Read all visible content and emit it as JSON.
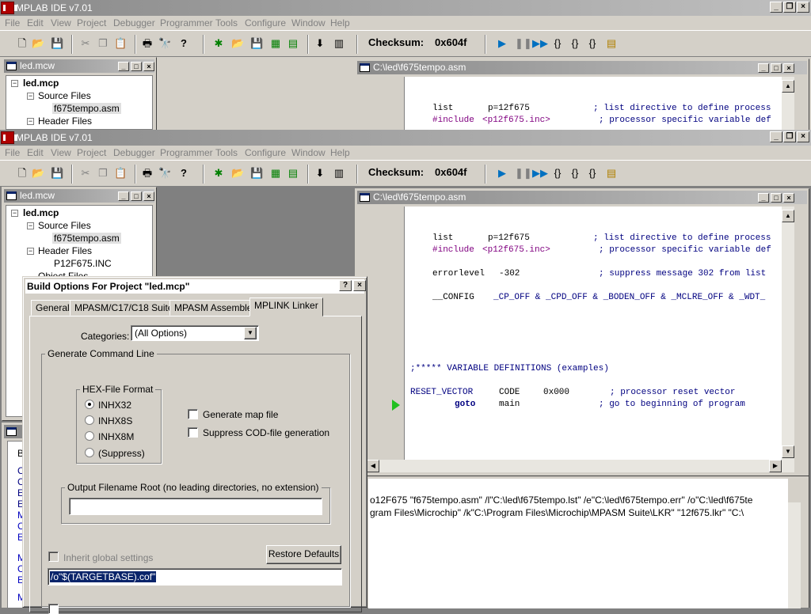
{
  "app": {
    "title": "MPLAB IDE v7.01",
    "menu": [
      "File",
      "Edit",
      "View",
      "Project",
      "Debugger",
      "Programmer",
      "Tools",
      "Configure",
      "Window",
      "Help"
    ],
    "checksum_label": "Checksum:",
    "checksum_value": "0x604f"
  },
  "project_window": {
    "title": "led.mcw",
    "tree": {
      "root": "led.mcp",
      "source_files": "Source Files",
      "source_file": "f675tempo.asm",
      "header_files": "Header Files",
      "header_file": "P12F675.INC",
      "object_files": "Object Files"
    }
  },
  "editor_window": {
    "title": "C:\\led\\f675tempo.asm",
    "lines": {
      "l1a": "list",
      "l1b": "p=12f675",
      "l1c": "; list directive to define process",
      "l2a": "#include",
      "l2b": "<p12f675.inc>",
      "l2c": "; processor specific variable def",
      "l3a": "errorlevel",
      "l3b": "-302",
      "l3c": "; suppress message 302 from list",
      "l4a": "__CONFIG",
      "l4b": "_CP_OFF & _CPD_OFF & _BODEN_OFF & _MCLRE_OFF & _WDT_",
      "l5": ";***** VARIABLE DEFINITIONS (examples)",
      "l6a": "RESET_VECTOR",
      "l6b": "CODE",
      "l6c": "0x000",
      "l6d": "; processor reset vector",
      "l7a": "goto",
      "l7b": "main",
      "l7c": "; go to beginning of program"
    }
  },
  "output_window": {
    "line1": "o12F675 \"f675tempo.asm\" /l\"C:\\led\\f675tempo.lst\" /e\"C:\\led\\f675tempo.err\" /o\"C:\\led\\f675te",
    "line2": "gram Files\\Microchip\" /k\"C:\\Program Files\\Microchip\\MPASM Suite\\LKR\" \"12f675.lkr\" \"C:\\",
    "left_letters": [
      "B",
      "C",
      "C",
      "E",
      "E",
      "M",
      "C",
      "E",
      "M",
      "C",
      "E",
      "M"
    ]
  },
  "dialog": {
    "title": "Build Options For Project \"led.mcp\"",
    "help_btn": "?",
    "close_btn": "×",
    "tabs": [
      "General",
      "MPASM/C17/C18 Suite",
      "MPASM Assembler",
      "MPLINK Linker"
    ],
    "categories_label": "Categories:",
    "categories_value": "(All Options)",
    "generate_group": "Generate Command Line",
    "hex_group": "HEX-File Format",
    "hex_options": [
      "INHX32",
      "INHX8S",
      "INHX8M",
      "(Suppress)"
    ],
    "hex_selected": "INHX32",
    "gen_map": "Generate map file",
    "suppress_cod": "Suppress COD-file generation",
    "output_group": "Output Filename Root (no leading directories, no extension)",
    "output_value": "",
    "inherit": "Inherit global settings",
    "restore": "Restore Defaults",
    "cmdline": "/o\"$(TARGETBASE).cof\""
  }
}
